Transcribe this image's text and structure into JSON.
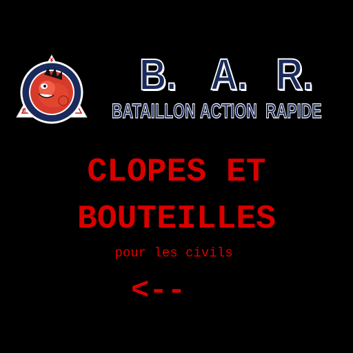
{
  "header": {
    "logo": {
      "ring_text": "BATAILLON ACTION RAPIDE",
      "icon": "mascot-emblem-icon"
    },
    "acronym": {
      "b": "B.",
      "a": "A.",
      "r": "R."
    },
    "words": {
      "w1": "BATAILLON",
      "w2": "ACTION",
      "w3": "RAPIDE"
    }
  },
  "content": {
    "title_line1": "CLOPES ET",
    "title_line2": "BOUTEILLES",
    "subtitle": "pour les civils",
    "back_arrow": "<--"
  },
  "colors": {
    "background": "#000000",
    "accent_red": "#d90000",
    "navy": "#1a2a5c"
  }
}
